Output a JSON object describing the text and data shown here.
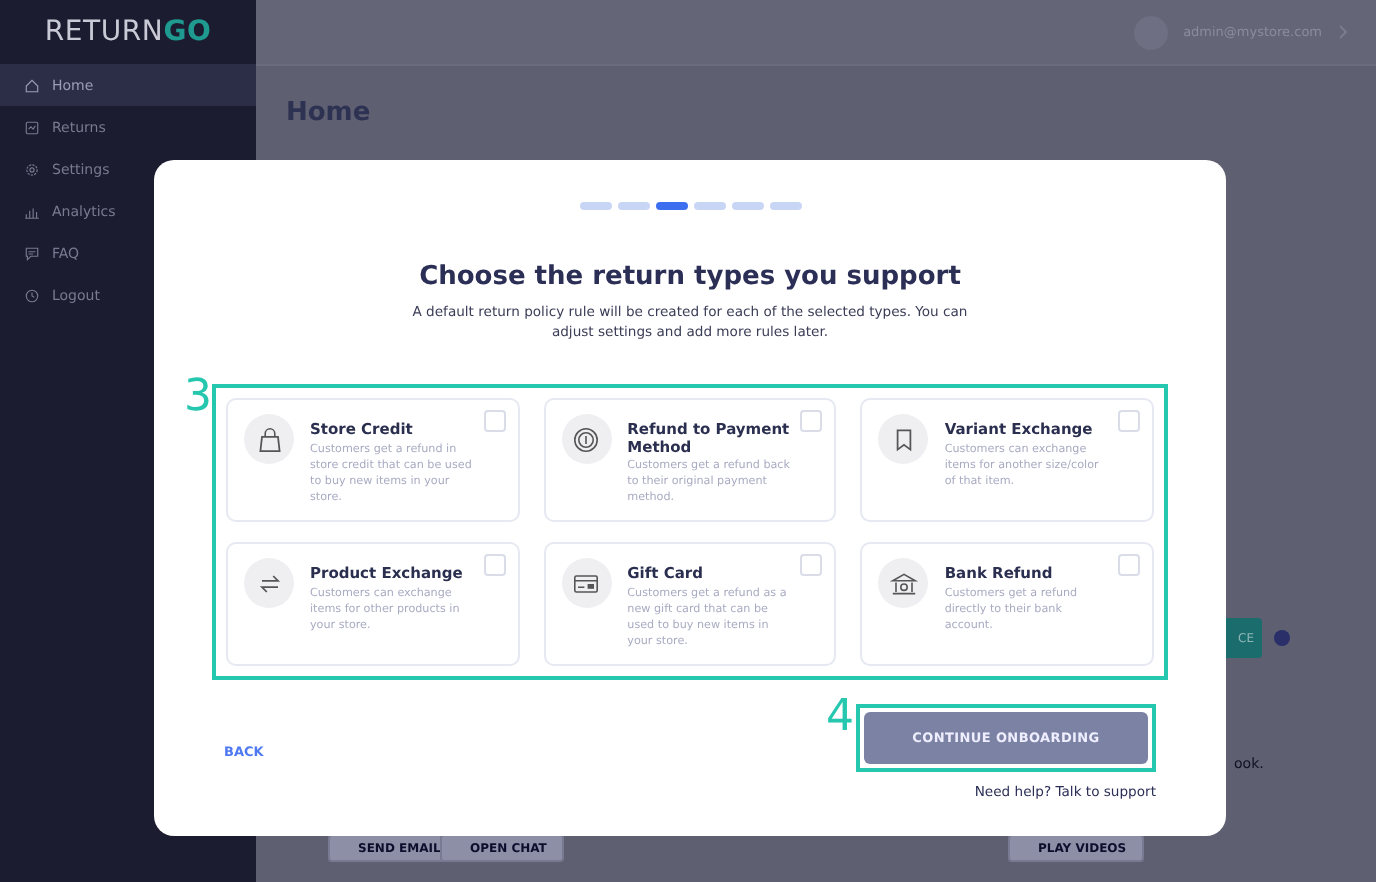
{
  "sidebar": {
    "logo": {
      "part_1": "RETURN",
      "part_2": "GO"
    },
    "items": [
      {
        "label": "Home",
        "selected": true
      },
      {
        "label": "Returns",
        "selected": false
      },
      {
        "label": "Settings",
        "selected": false
      },
      {
        "label": "Analytics",
        "selected": false
      },
      {
        "label": "FAQ",
        "selected": false
      },
      {
        "label": "Logout",
        "selected": false
      }
    ]
  },
  "header": {
    "user": "admin@mystore.com"
  },
  "page": {
    "title": "Home",
    "partial_button": "CE",
    "partial_text": "ook.",
    "bottom_buttons": [
      "SEND EMAIL",
      "OPEN CHAT",
      "PLAY VIDEOS"
    ]
  },
  "modal": {
    "steps": [
      {
        "selected": false
      },
      {
        "selected": false
      },
      {
        "selected": true
      },
      {
        "selected": false
      },
      {
        "selected": false
      },
      {
        "selected": false
      }
    ],
    "title": "Choose the return types you support",
    "subtitle": "A default return policy rule will be created for each of the selected types. You can adjust settings and add more rules later.",
    "options": [
      {
        "name": "Store Credit",
        "description": "Customers get a refund in store credit that can be used to buy new items in your store.",
        "checked": false
      },
      {
        "name": "Refund to Payment Method",
        "description": "Customers get a refund back to their original payment method.",
        "checked": false
      },
      {
        "name": "Variant Exchange",
        "description": "Customers can exchange items for another size/color of that item.",
        "checked": false
      },
      {
        "name": "Product Exchange",
        "description": "Customers can exchange items for other products in your store.",
        "checked": false
      },
      {
        "name": "Gift Card",
        "description": "Customers get a refund as a new gift card that can be used to buy new items in your store.",
        "checked": false
      },
      {
        "name": "Bank Refund",
        "description": "Customers get a refund directly to their bank account.",
        "checked": false
      }
    ],
    "back": "BACK",
    "continue": {
      "label": "CONTINUE ONBOARDING",
      "disabled": true
    },
    "help": {
      "text": "Need help?",
      "link": "Talk to support"
    }
  },
  "annotations": [
    "3",
    "4"
  ]
}
